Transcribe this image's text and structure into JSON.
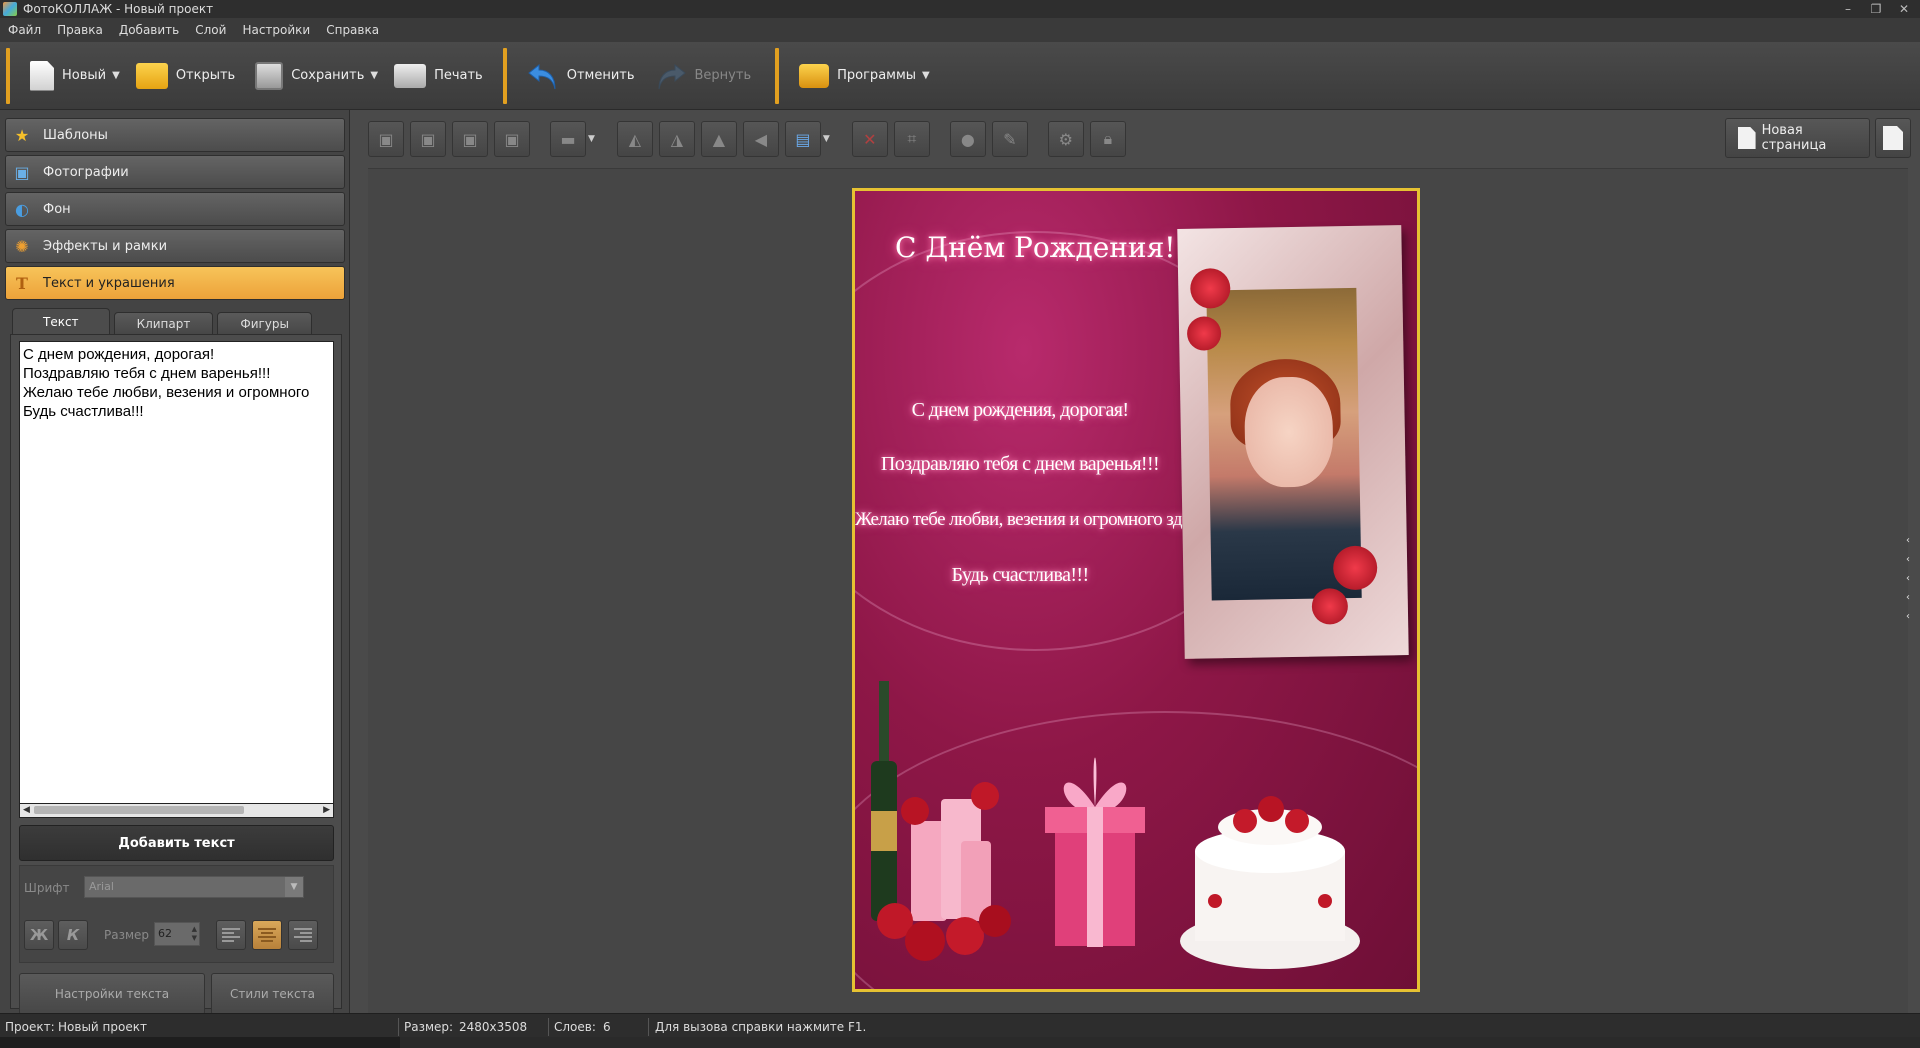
{
  "window": {
    "title": "ФотоКОЛЛАЖ - Новый проект",
    "controls": [
      "–",
      "❐",
      "✕"
    ]
  },
  "menu": [
    "Файл",
    "Правка",
    "Добавить",
    "Слой",
    "Настройки",
    "Справка"
  ],
  "toolbar": {
    "new_label": "Новый",
    "open_label": "Открыть",
    "save_label": "Сохранить",
    "print_label": "Печать",
    "undo_label": "Отменить",
    "redo_label": "Вернуть",
    "programs_label": "Программы",
    "dropdown_glyph": "▼"
  },
  "sidebar": {
    "items": [
      {
        "label": "Шаблоны",
        "icon": "star-icon",
        "glyph": "★"
      },
      {
        "label": "Фотографии",
        "icon": "photo-icon",
        "glyph": "▣"
      },
      {
        "label": "Фон",
        "icon": "background-icon",
        "glyph": "◐"
      },
      {
        "label": "Эффекты и рамки",
        "icon": "palette-icon",
        "glyph": "✺"
      },
      {
        "label": "Текст и украшения",
        "icon": "text-icon",
        "glyph": "T"
      }
    ],
    "active_index": 4
  },
  "tabs": [
    "Текст",
    "Клипарт",
    "Фигуры"
  ],
  "text_panel": {
    "lines": [
      "С днем рождения, дорогая!",
      "Поздравляю тебя с днем варенья!!!",
      "Желаю тебе любви, везения и огромного",
      "Будь счастлива!!!"
    ],
    "add_button": "Добавить текст",
    "font_label": "Шрифт",
    "font_value": "Arial",
    "bold_glyph": "Ж",
    "italic_glyph": "К",
    "size_label": "Размер",
    "size_value": "62",
    "text_settings": "Настройки текста",
    "text_styles": "Стили текста"
  },
  "canvas_toolbar": {
    "new_page_label": "Новая страница"
  },
  "collage": {
    "title": "С Днём Рождения!",
    "lines": [
      "С днем рождения, дорогая!",
      "Поздравляю тебя с днем варенья!!!",
      "Желаю тебе любви, везения и огромного здоровья!",
      "Будь счастлива!!!"
    ]
  },
  "status": {
    "project_label": "Проект:",
    "project_value": "Новый проект",
    "size_label": "Размер:",
    "size_value": "2480x3508",
    "layers_label": "Слоев:",
    "layers_value": "6",
    "help": "Для вызова справки нажмите F1."
  }
}
